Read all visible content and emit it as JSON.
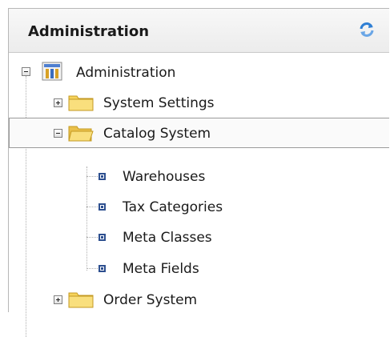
{
  "header": {
    "title": "Administration",
    "refresh_icon": "refresh-icon"
  },
  "tree": {
    "root": {
      "label": "Administration",
      "state": "expanded",
      "icon": "admin-tools-icon"
    },
    "items": [
      {
        "label": "System Settings",
        "state": "collapsed",
        "icon": "folder-icon"
      },
      {
        "label": "Catalog System",
        "state": "expanded",
        "icon": "folder-open-icon",
        "selected": true
      },
      {
        "label": "Order System",
        "state": "collapsed",
        "icon": "folder-icon"
      }
    ],
    "catalog_children": [
      {
        "label": "Warehouses",
        "icon": "leaf-node-icon"
      },
      {
        "label": "Tax Categories",
        "icon": "leaf-node-icon"
      },
      {
        "label": "Meta Classes",
        "icon": "leaf-node-icon"
      },
      {
        "label": "Meta Fields",
        "icon": "leaf-node-icon"
      }
    ]
  },
  "colors": {
    "selection_border": "#9a9a9a",
    "folder_yellow": "#f6d35b",
    "leaf_blue": "#2d4f8f"
  }
}
